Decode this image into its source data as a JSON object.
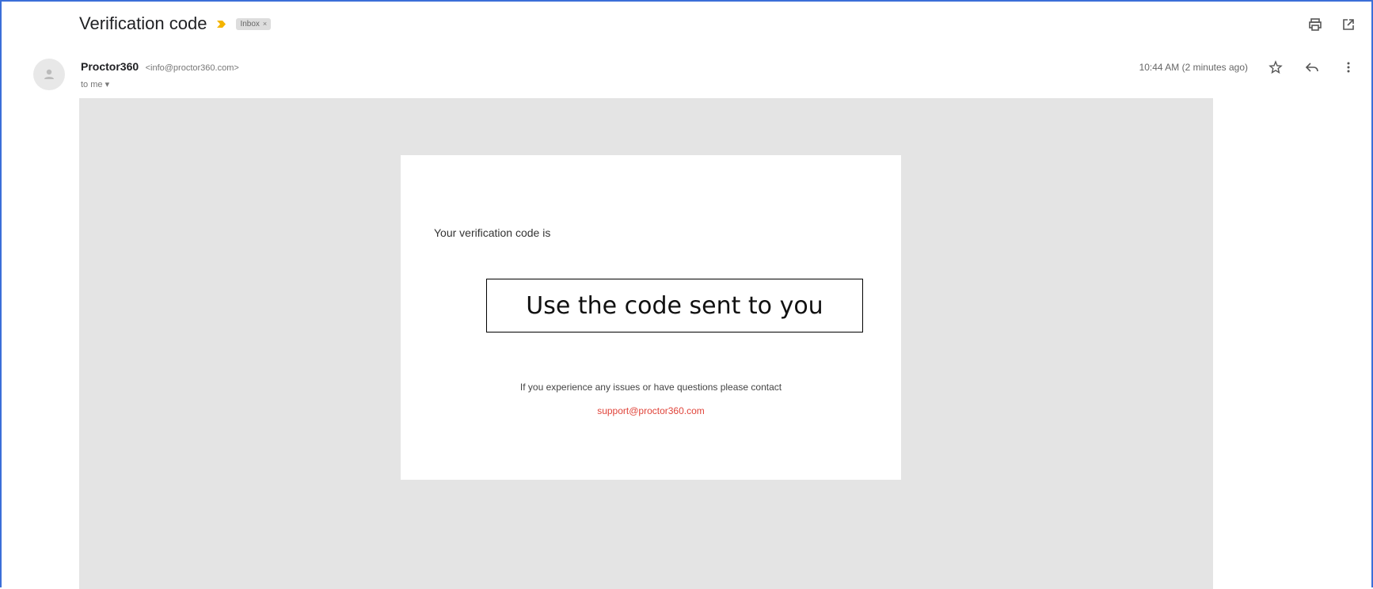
{
  "email": {
    "subject": "Verification code",
    "label": "Inbox",
    "label_close": "×",
    "sender_name": "Proctor360",
    "sender_email": "<info@proctor360.com>",
    "recipient": "to me ▾",
    "timestamp": "10:44 AM (2 minutes ago)"
  },
  "body": {
    "intro": "Your verification code is",
    "code_placeholder": "Use the code sent to you",
    "contact_text": "If you experience any issues or have questions please contact",
    "support_email": "support@proctor360.com"
  },
  "icons": {
    "important": "important-marker-icon",
    "print": "print-icon",
    "new_window": "open-in-new-window-icon",
    "avatar": "person-icon",
    "star": "star-icon",
    "reply": "reply-icon",
    "more": "more-vert-icon"
  },
  "colors": {
    "frame_border": "#3b6fd8",
    "important_marker": "#f4b400",
    "canvas_bg": "#e4e4e4",
    "support_link": "#e0443a"
  }
}
